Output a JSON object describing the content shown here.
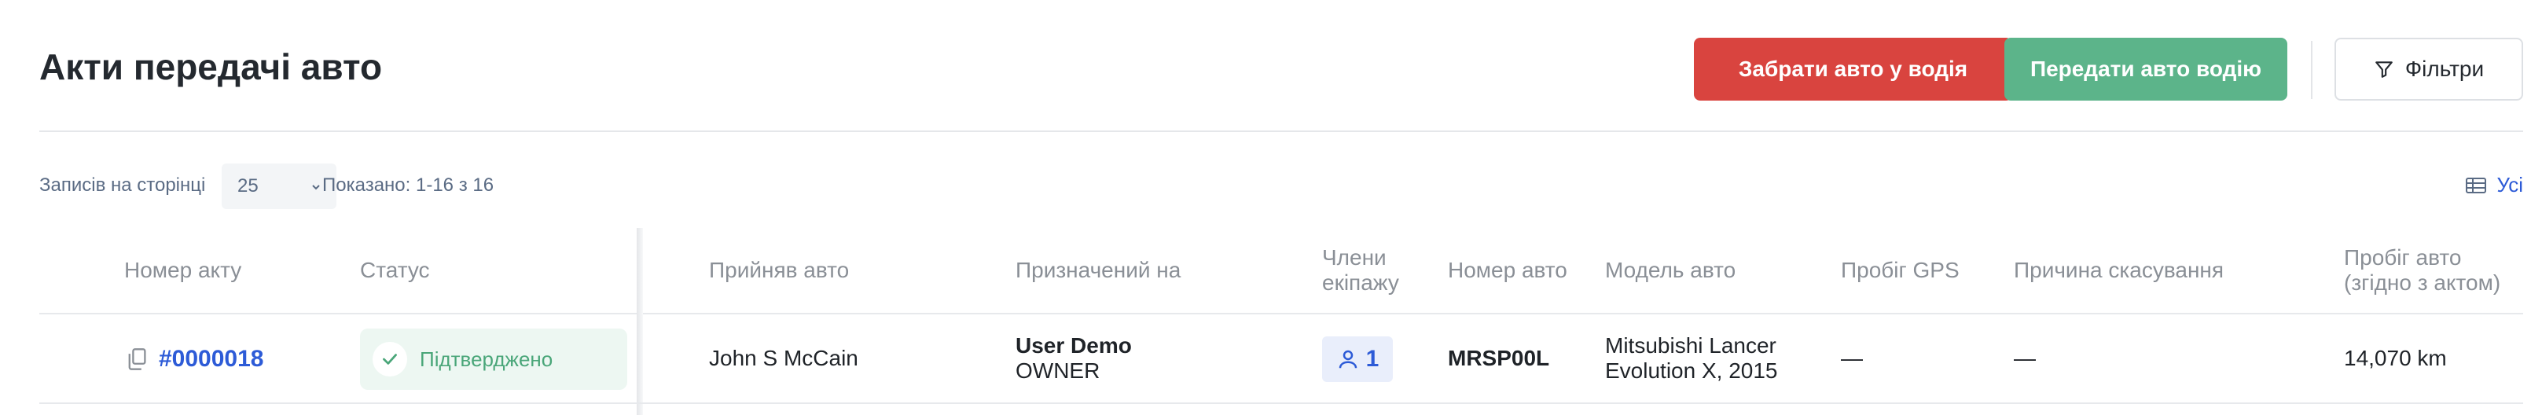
{
  "header": {
    "title": "Акти передачі авто",
    "take_button": "Забрати авто у водія",
    "give_button": "Передати авто водію",
    "filter_button": "Фільтри"
  },
  "toolbar": {
    "per_page_label": "Записів на сторінці",
    "per_page_value": "25",
    "shown_label": "Показано: 1-16 з 16",
    "columns_button": "Усі"
  },
  "table": {
    "columns": {
      "act_number": "Номер акту",
      "status": "Статус",
      "accepted_by": "Прийняв авто",
      "assigned_to": "Призначений на",
      "crew_line1": "Члени",
      "crew_line2": "екіпажу",
      "car_number": "Номер авто",
      "car_model": "Модель авто",
      "gps_mileage": "Пробіг GPS",
      "cancel_reason": "Причина скасування",
      "act_mileage_line1": "Пробіг авто",
      "act_mileage_line2": "(згідно з актом)"
    },
    "rows": [
      {
        "act_number": "#0000018",
        "status": "Підтверджено",
        "accepted_by": "John S McCain",
        "assigned_name": "User Demo",
        "assigned_role": "OWNER",
        "crew_count": "1",
        "car_number": "MRSP00L",
        "car_model_line1": "Mitsubishi Lancer",
        "car_model_line2": "Evolution X, 2015",
        "gps_mileage": "—",
        "cancel_reason": "—",
        "act_mileage": "14,070 km"
      }
    ]
  },
  "colors": {
    "danger": "#d9443f",
    "success": "#5cb48a",
    "link": "#2d5bd7",
    "status_bg": "#edf7f2"
  },
  "icons": {
    "filter": "filter-icon",
    "chevron": "chevron-down-icon",
    "columns": "table-columns-icon",
    "copy": "copy-icon",
    "check": "check-icon",
    "user": "user-icon"
  }
}
